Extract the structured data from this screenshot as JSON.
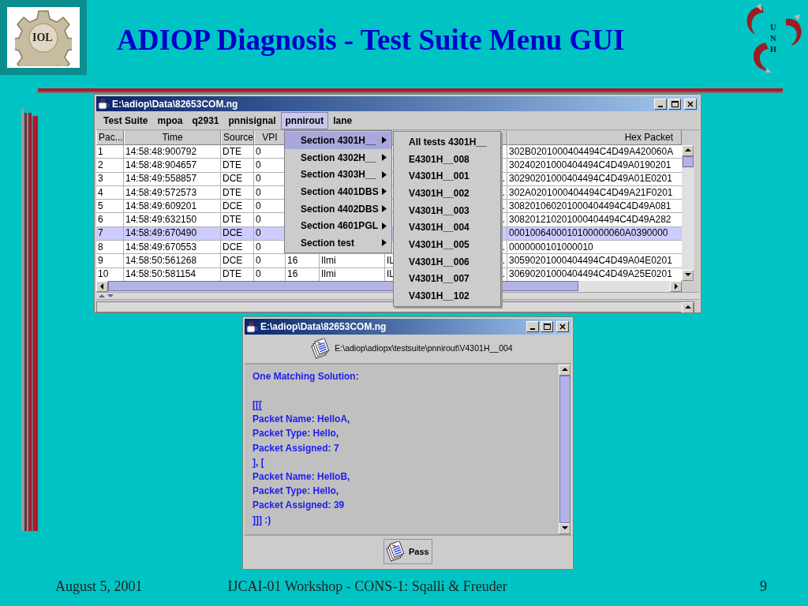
{
  "slide": {
    "logo": {
      "text": "IOL"
    },
    "title": "ADIOP Diagnosis - Test Suite Menu GUI",
    "emblem": {
      "letters": [
        "U",
        "N",
        "H"
      ]
    },
    "footer": {
      "date": "August 5, 2001",
      "event": "IJCAI-01 Workshop - CONS-1: Sqalli & Freuder",
      "page": "9"
    }
  },
  "main_window": {
    "title": "E:\\adiop\\Data\\82653COM.ng",
    "menu": [
      {
        "label": "Test Suite",
        "selected": false
      },
      {
        "label": "mpoa",
        "selected": false
      },
      {
        "label": "q2931",
        "selected": false
      },
      {
        "label": "pnnisignal",
        "selected": false
      },
      {
        "label": "pnnirout",
        "selected": true
      },
      {
        "label": "lane",
        "selected": false
      }
    ],
    "table": {
      "columns": [
        "Pac...",
        "Time",
        "Source",
        "VPI"
      ],
      "hex_header": "Hex Packet",
      "rows": [
        {
          "number": "1",
          "time": "14:58:48:900792",
          "source": "DTE",
          "vpi": "0",
          "hex": "302B0201000404494C4D49A420060A",
          "selected": false
        },
        {
          "number": "2",
          "time": "14:58:48:904657",
          "source": "DTE",
          "vpi": "0",
          "hex": "30240201000404494C4D49A0190201",
          "selected": false
        },
        {
          "number": "3",
          "time": "14:58:49:558857",
          "source": "DCE",
          "vpi": "0",
          "column_7_tail": "..",
          "hex": "30290201000404494C4D49A01E0201",
          "selected": false
        },
        {
          "number": "4",
          "time": "14:58:49:572573",
          "source": "DTE",
          "vpi": "0",
          "column_7_tail": "..",
          "hex": "302A0201000404494C4D49A21F0201",
          "selected": false
        },
        {
          "number": "5",
          "time": "14:58:49:609201",
          "source": "DCE",
          "vpi": "0",
          "column_7_tail": "..",
          "hex": "308201060201000404494C4D49A081",
          "selected": false
        },
        {
          "number": "6",
          "time": "14:58:49:632150",
          "source": "DTE",
          "vpi": "0",
          "column_7_tail": "..",
          "hex": "308201210201000404494C4D49A282",
          "selected": false
        },
        {
          "number": "7",
          "time": "14:58:49:670490",
          "source": "DCE",
          "vpi": "0",
          "hex": "0001006400010100000060A0390000",
          "selected": true
        },
        {
          "number": "8",
          "time": "14:58:49:670553",
          "source": "DCE",
          "vpi": "0",
          "column_7_tail": "..",
          "hex": "0000000101000010",
          "selected": false
        },
        {
          "number": "9",
          "time": "14:58:50:561268",
          "source": "DCE",
          "vpi": "0",
          "column_5": "16",
          "column_6": "Ilmi",
          "column_7": "IL",
          "column_7_tail": "..",
          "hex": "30590201000404494C4D49A04E0201",
          "selected": false
        },
        {
          "number": "10",
          "time": "14:58:50:581154",
          "source": "DTE",
          "vpi": "0",
          "column_5": "16",
          "column_6": "Ilmi",
          "column_7": "IL",
          "column_7_tail": "..",
          "hex": "30690201000404494C4D49A25E0201",
          "selected": false
        }
      ]
    },
    "popup_menu": [
      {
        "label": "Section 4301H__",
        "selected": true
      },
      {
        "label": "Section 4302H__",
        "selected": false
      },
      {
        "label": "Section 4303H__",
        "selected": false
      },
      {
        "label": "Section 4401DBS",
        "selected": false
      },
      {
        "label": "Section 4402DBS",
        "selected": false
      },
      {
        "label": "Section 4601PGL",
        "selected": false
      },
      {
        "label": "Section test",
        "selected": false
      }
    ],
    "submenu": [
      "All tests 4301H__",
      "E4301H__008",
      "V4301H__001",
      "V4301H__002",
      "V4301H__003",
      "V4301H__004",
      "V4301H__005",
      "V4301H__006",
      "V4301H__007",
      "V4301H__102"
    ]
  },
  "result_window": {
    "title": "E:\\adiop\\Data\\82653COM.ng",
    "path": "E:\\adiop\\adiopx\\testsuite\\pnnirout\\V4301H__004",
    "heading": "One Matching Solution:",
    "lines": [
      "[[[",
      "Packet Name: HelloA,",
      "Packet Type: Hello,",
      "Packet Assigned: 7",
      "], [",
      "Packet Name: HelloB,",
      "Packet Type: Hello,",
      "Packet Assigned: 39",
      "]]] :)"
    ],
    "button": "Pass"
  }
}
